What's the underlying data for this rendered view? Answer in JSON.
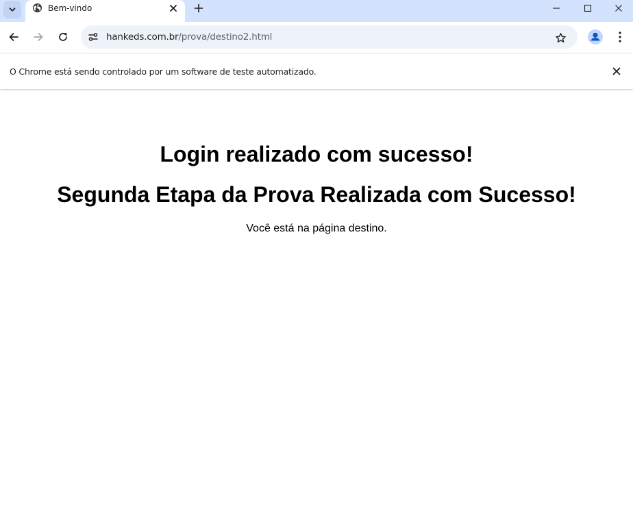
{
  "browser": {
    "tab": {
      "title": "Bem-vindo"
    },
    "omnibox": {
      "host": "hankeds.com.br",
      "path": "/prova/destino2.html"
    },
    "infobar": {
      "message": "O Chrome está sendo controlado por um software de teste automatizado."
    },
    "colors": {
      "tabstrip": "#d3e3fd",
      "omnibox": "#eef2f9",
      "profile_accent": "#0b57d0"
    }
  },
  "page": {
    "heading1": "Login realizado com sucesso!",
    "heading2": "Segunda Etapa da Prova Realizada com Sucesso!",
    "paragraph": "Você está na página destino."
  }
}
